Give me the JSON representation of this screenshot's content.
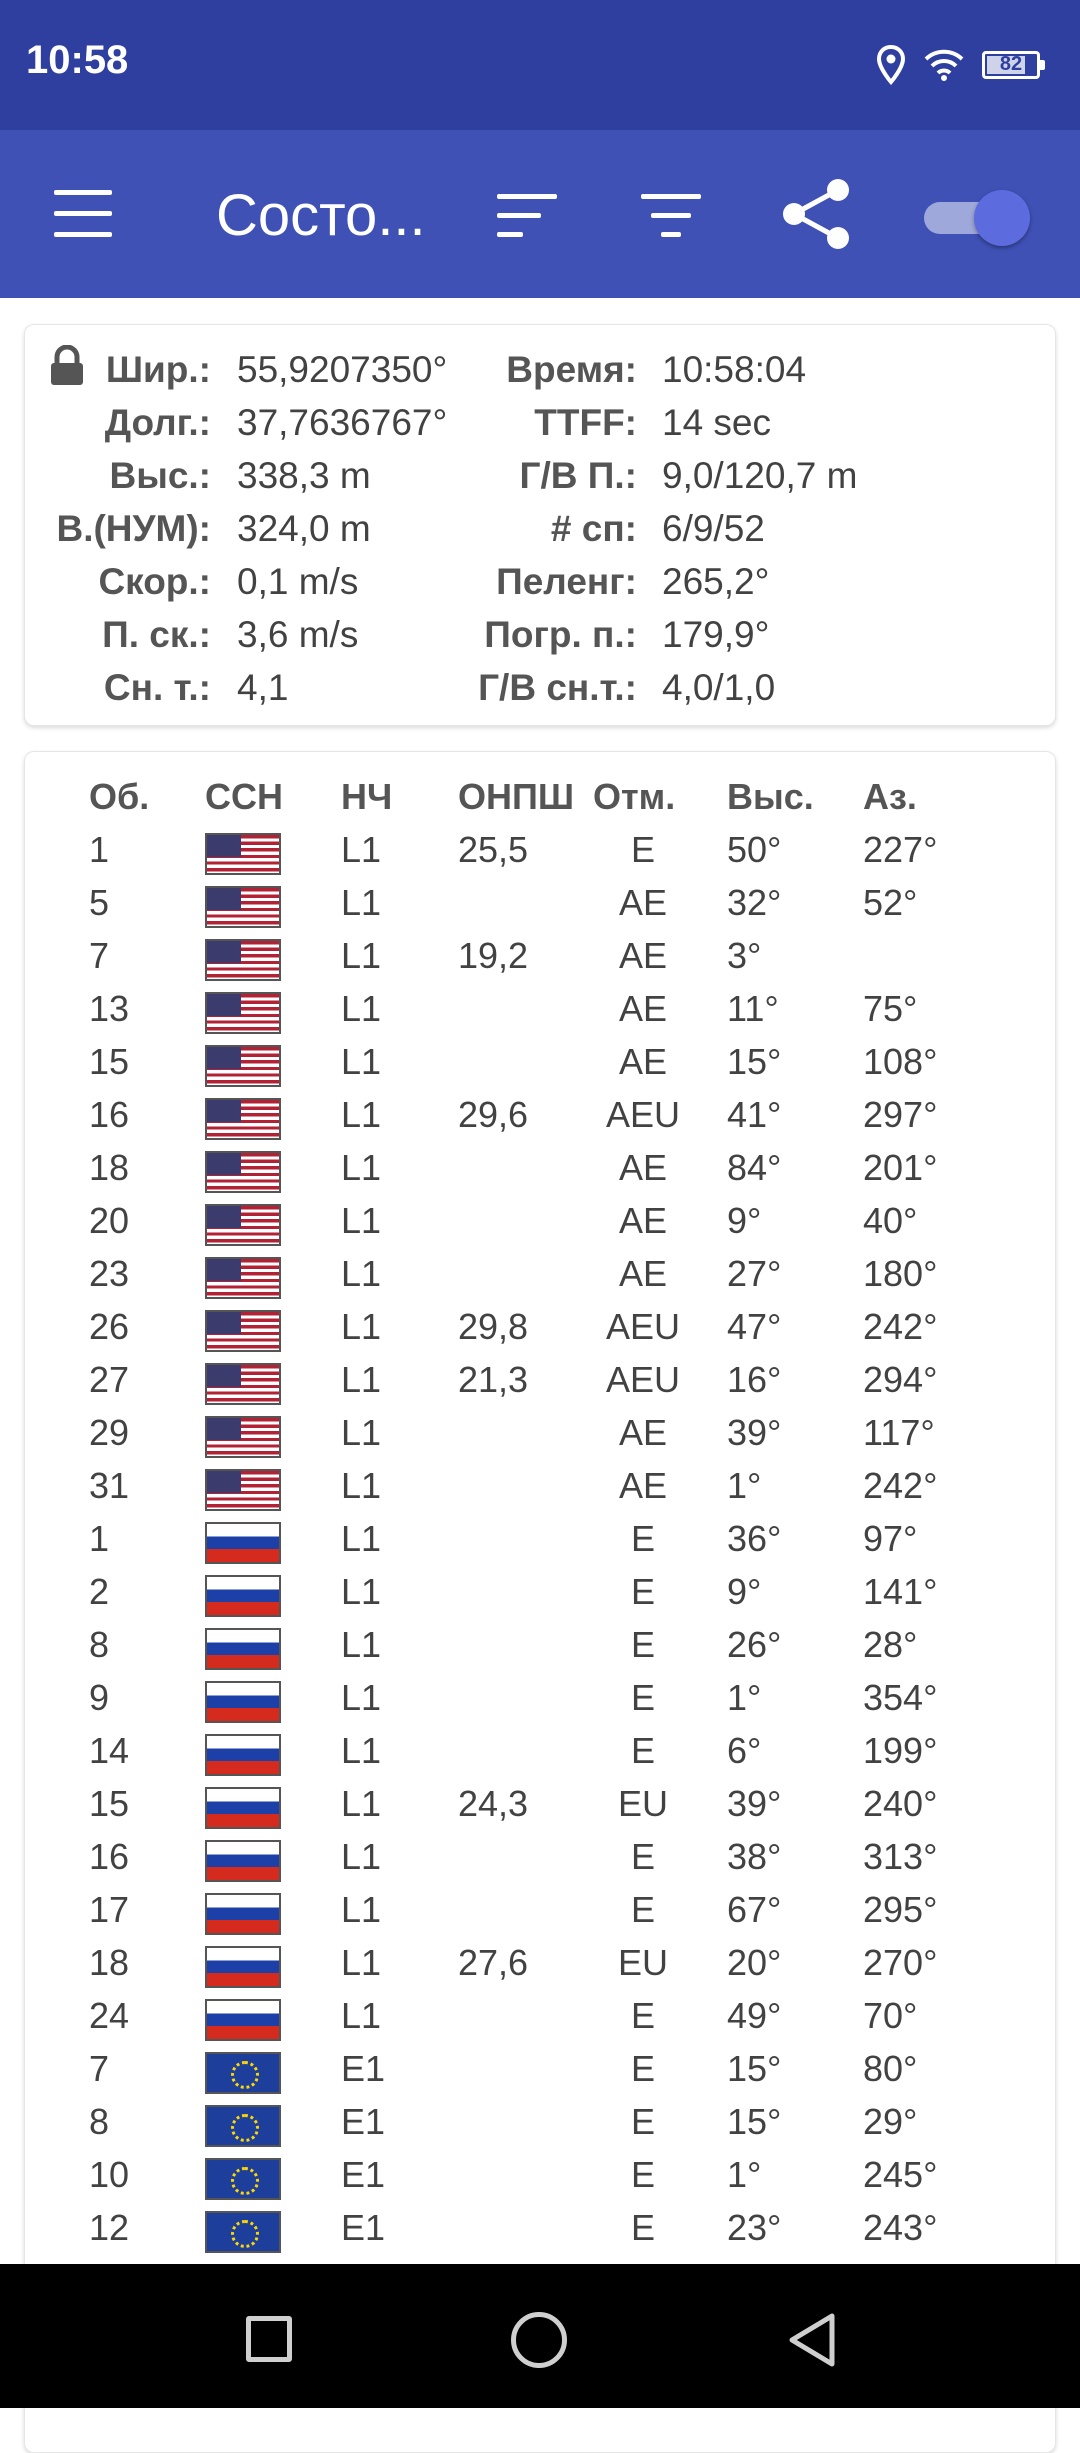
{
  "status_bar": {
    "time": "10:58",
    "battery": "82"
  },
  "app_bar": {
    "title": "Состо..."
  },
  "info": {
    "left": [
      {
        "label": "Шир.:",
        "value": "55,9207350°"
      },
      {
        "label": "Долг.:",
        "value": "37,7636767°"
      },
      {
        "label": "Выс.:",
        "value": "338,3 m"
      },
      {
        "label": "В.(НУМ):",
        "value": "324,0 m"
      },
      {
        "label": "Скор.:",
        "value": "0,1 m/s"
      },
      {
        "label": "П. ск.:",
        "value": "3,6 m/s"
      },
      {
        "label": "Сн. т.:",
        "value": "4,1"
      }
    ],
    "right": [
      {
        "label": "Время:",
        "value": "10:58:04"
      },
      {
        "label": "TTFF:",
        "value": "14 sec"
      },
      {
        "label": "Г/В П.:",
        "value": "9,0/120,7 m"
      },
      {
        "label": "# сп:",
        "value": "6/9/52"
      },
      {
        "label": "Пеленг:",
        "value": "265,2°"
      },
      {
        "label": "Погр. п.:",
        "value": "179,9°"
      },
      {
        "label": "Г/В сн.т.:",
        "value": "4,0/1,0"
      }
    ]
  },
  "table": {
    "headers": {
      "id": "Об.",
      "flag": "ССН",
      "freq": "НЧ",
      "cn0": "ОНПШ",
      "flags": "Отм.",
      "elev": "Выс.",
      "az": "Аз."
    },
    "rows": [
      {
        "id": "1",
        "flag": "usa",
        "freq": "L1",
        "cn0": "25,5",
        "flags": "E",
        "elev": "50°",
        "az": "227°"
      },
      {
        "id": "5",
        "flag": "usa",
        "freq": "L1",
        "cn0": "",
        "flags": "AE",
        "elev": "32°",
        "az": "52°"
      },
      {
        "id": "7",
        "flag": "usa",
        "freq": "L1",
        "cn0": "19,2",
        "flags": "AE",
        "elev": "3°",
        "az": ""
      },
      {
        "id": "13",
        "flag": "usa",
        "freq": "L1",
        "cn0": "",
        "flags": "AE",
        "elev": "11°",
        "az": "75°"
      },
      {
        "id": "15",
        "flag": "usa",
        "freq": "L1",
        "cn0": "",
        "flags": "AE",
        "elev": "15°",
        "az": "108°"
      },
      {
        "id": "16",
        "flag": "usa",
        "freq": "L1",
        "cn0": "29,6",
        "flags": "AEU",
        "elev": "41°",
        "az": "297°"
      },
      {
        "id": "18",
        "flag": "usa",
        "freq": "L1",
        "cn0": "",
        "flags": "AE",
        "elev": "84°",
        "az": "201°"
      },
      {
        "id": "20",
        "flag": "usa",
        "freq": "L1",
        "cn0": "",
        "flags": "AE",
        "elev": "9°",
        "az": "40°"
      },
      {
        "id": "23",
        "flag": "usa",
        "freq": "L1",
        "cn0": "",
        "flags": "AE",
        "elev": "27°",
        "az": "180°"
      },
      {
        "id": "26",
        "flag": "usa",
        "freq": "L1",
        "cn0": "29,8",
        "flags": "AEU",
        "elev": "47°",
        "az": "242°"
      },
      {
        "id": "27",
        "flag": "usa",
        "freq": "L1",
        "cn0": "21,3",
        "flags": "AEU",
        "elev": "16°",
        "az": "294°"
      },
      {
        "id": "29",
        "flag": "usa",
        "freq": "L1",
        "cn0": "",
        "flags": "AE",
        "elev": "39°",
        "az": "117°"
      },
      {
        "id": "31",
        "flag": "usa",
        "freq": "L1",
        "cn0": "",
        "flags": "AE",
        "elev": "1°",
        "az": "242°"
      },
      {
        "id": "1",
        "flag": "rus",
        "freq": "L1",
        "cn0": "",
        "flags": "E",
        "elev": "36°",
        "az": "97°"
      },
      {
        "id": "2",
        "flag": "rus",
        "freq": "L1",
        "cn0": "",
        "flags": "E",
        "elev": "9°",
        "az": "141°"
      },
      {
        "id": "8",
        "flag": "rus",
        "freq": "L1",
        "cn0": "",
        "flags": "E",
        "elev": "26°",
        "az": "28°"
      },
      {
        "id": "9",
        "flag": "rus",
        "freq": "L1",
        "cn0": "",
        "flags": "E",
        "elev": "1°",
        "az": "354°"
      },
      {
        "id": "14",
        "flag": "rus",
        "freq": "L1",
        "cn0": "",
        "flags": "E",
        "elev": "6°",
        "az": "199°"
      },
      {
        "id": "15",
        "flag": "rus",
        "freq": "L1",
        "cn0": "24,3",
        "flags": "EU",
        "elev": "39°",
        "az": "240°"
      },
      {
        "id": "16",
        "flag": "rus",
        "freq": "L1",
        "cn0": "",
        "flags": "E",
        "elev": "38°",
        "az": "313°"
      },
      {
        "id": "17",
        "flag": "rus",
        "freq": "L1",
        "cn0": "",
        "flags": "E",
        "elev": "67°",
        "az": "295°"
      },
      {
        "id": "18",
        "flag": "rus",
        "freq": "L1",
        "cn0": "27,6",
        "flags": "EU",
        "elev": "20°",
        "az": "270°"
      },
      {
        "id": "24",
        "flag": "rus",
        "freq": "L1",
        "cn0": "",
        "flags": "E",
        "elev": "49°",
        "az": "70°"
      },
      {
        "id": "7",
        "flag": "eu",
        "freq": "E1",
        "cn0": "",
        "flags": "E",
        "elev": "15°",
        "az": "80°"
      },
      {
        "id": "8",
        "flag": "eu",
        "freq": "E1",
        "cn0": "",
        "flags": "E",
        "elev": "15°",
        "az": "29°"
      },
      {
        "id": "10",
        "flag": "eu",
        "freq": "E1",
        "cn0": "",
        "flags": "E",
        "elev": "1°",
        "az": "245°"
      },
      {
        "id": "12",
        "flag": "eu",
        "freq": "E1",
        "cn0": "",
        "flags": "E",
        "elev": "23°",
        "az": "243°"
      }
    ]
  }
}
